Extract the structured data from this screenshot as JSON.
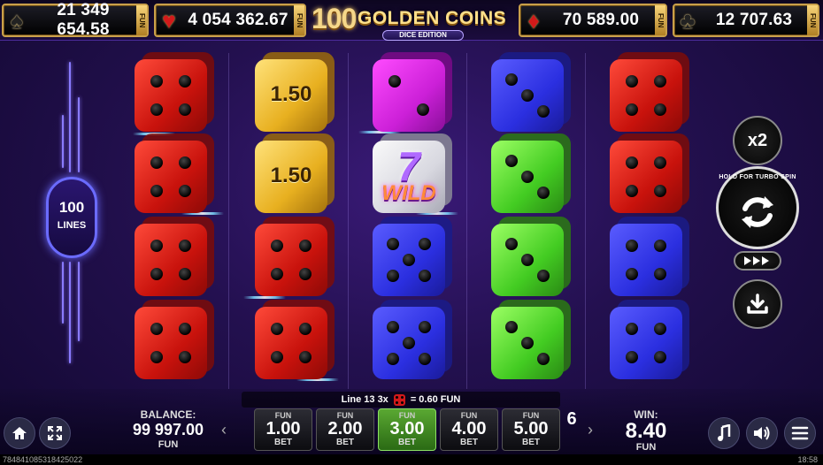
{
  "jackpots": [
    {
      "suit": "spade",
      "glyph": "♠",
      "value": "21 349 654.58",
      "tag": "FUN"
    },
    {
      "suit": "heart",
      "glyph": "♥",
      "value": "4 054 362.67",
      "tag": "FUN"
    },
    {
      "suit": "diamond",
      "glyph": "♦",
      "value": "70 589.00",
      "tag": "FUN"
    },
    {
      "suit": "club",
      "glyph": "♣",
      "value": "12 707.63",
      "tag": "FUN"
    }
  ],
  "logo": {
    "number": "100",
    "title": "GOLDEN COINS",
    "subtitle": "DICE EDITION"
  },
  "lines": {
    "count": "100",
    "label": "LINES"
  },
  "reels": [
    [
      {
        "color": "red",
        "pips": 4
      },
      {
        "color": "red",
        "pips": 4
      },
      {
        "color": "red",
        "pips": 4
      },
      {
        "color": "red",
        "pips": 4
      }
    ],
    [
      {
        "color": "gold",
        "label": "1.50"
      },
      {
        "color": "gold",
        "label": "1.50"
      },
      {
        "color": "red",
        "pips": 4
      },
      {
        "color": "red",
        "pips": 4
      }
    ],
    [
      {
        "color": "purple",
        "pips": 2
      },
      {
        "color": "white",
        "wild": true,
        "seven": "7",
        "word": "WILD"
      },
      {
        "color": "blue",
        "pips": 5
      },
      {
        "color": "blue",
        "pips": 5
      }
    ],
    [
      {
        "color": "blue",
        "pips": 3
      },
      {
        "color": "green",
        "pips": 3
      },
      {
        "color": "green",
        "pips": 3
      },
      {
        "color": "green",
        "pips": 3
      }
    ],
    [
      {
        "color": "red",
        "pips": 4
      },
      {
        "color": "red",
        "pips": 4
      },
      {
        "color": "blue",
        "pips": 4
      },
      {
        "color": "blue",
        "pips": 4
      }
    ]
  ],
  "controls": {
    "multiplier": "x2",
    "spin_hint": "HOLD FOR TURBO SPIN",
    "spin_icon": "refresh-icon",
    "turbo_icon": "fast-forward-icon",
    "autoplay_icon": "download-icon"
  },
  "win_line": {
    "text": "Line 13 3x",
    "payout": "= 0.60 FUN"
  },
  "balance": {
    "label": "BALANCE:",
    "amount": "99 997.00",
    "currency": "FUN"
  },
  "bets": [
    {
      "tag": "FUN",
      "value": "1.00",
      "label": "BET",
      "selected": false
    },
    {
      "tag": "FUN",
      "value": "2.00",
      "label": "BET",
      "selected": false
    },
    {
      "tag": "FUN",
      "value": "3.00",
      "label": "BET",
      "selected": true
    },
    {
      "tag": "FUN",
      "value": "4.00",
      "label": "BET",
      "selected": false
    },
    {
      "tag": "FUN",
      "value": "5.00",
      "label": "BET",
      "selected": false
    },
    {
      "tag": "",
      "value": "6",
      "label": "",
      "selected": false
    }
  ],
  "win": {
    "label": "WIN:",
    "amount": "8.40",
    "currency": "FUN"
  },
  "nav": {
    "prev": "‹",
    "next": "›"
  },
  "bottom_icons": {
    "home": "home-icon",
    "fullscreen": "fullscreen-icon",
    "music": "music-icon",
    "sound": "sound-icon",
    "menu": "menu-icon"
  },
  "status": {
    "session_id": "7848410853184250​22",
    "time": "18:58"
  }
}
